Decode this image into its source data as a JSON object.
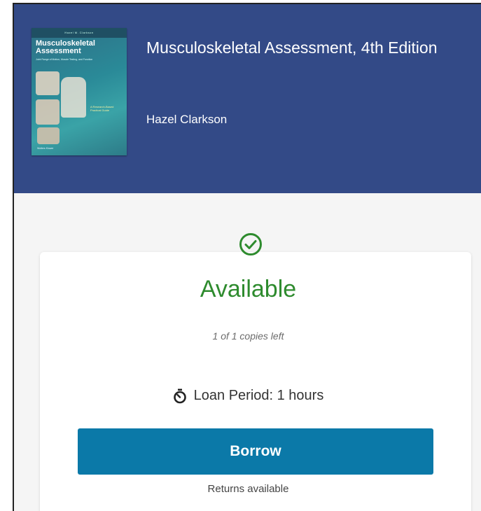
{
  "book": {
    "title": "Musculoskeletal Assessment, 4th Edition",
    "author": "Hazel Clarkson",
    "cover": {
      "title_line1": "Musculoskeletal",
      "title_line2": "Assessment",
      "author_strip": "Hazel M. Clarkson",
      "subtitle": "Joint Range of Motion, Muscle Testing, and Function",
      "blurb": "A Research-Based Practical Guide",
      "publisher": "Wolters Kluwer"
    }
  },
  "availability": {
    "status": "Available",
    "copies_left": "1 of 1 copies left",
    "loan_period": "Loan Period: 1 hours",
    "borrow_label": "Borrow",
    "returns_note": "Returns available"
  },
  "colors": {
    "header_bg": "#334a87",
    "available_green": "#2e8b2e",
    "borrow_button": "#0b79a8"
  },
  "icons": {
    "status": "check-circle-icon",
    "loan": "stopwatch-icon"
  }
}
